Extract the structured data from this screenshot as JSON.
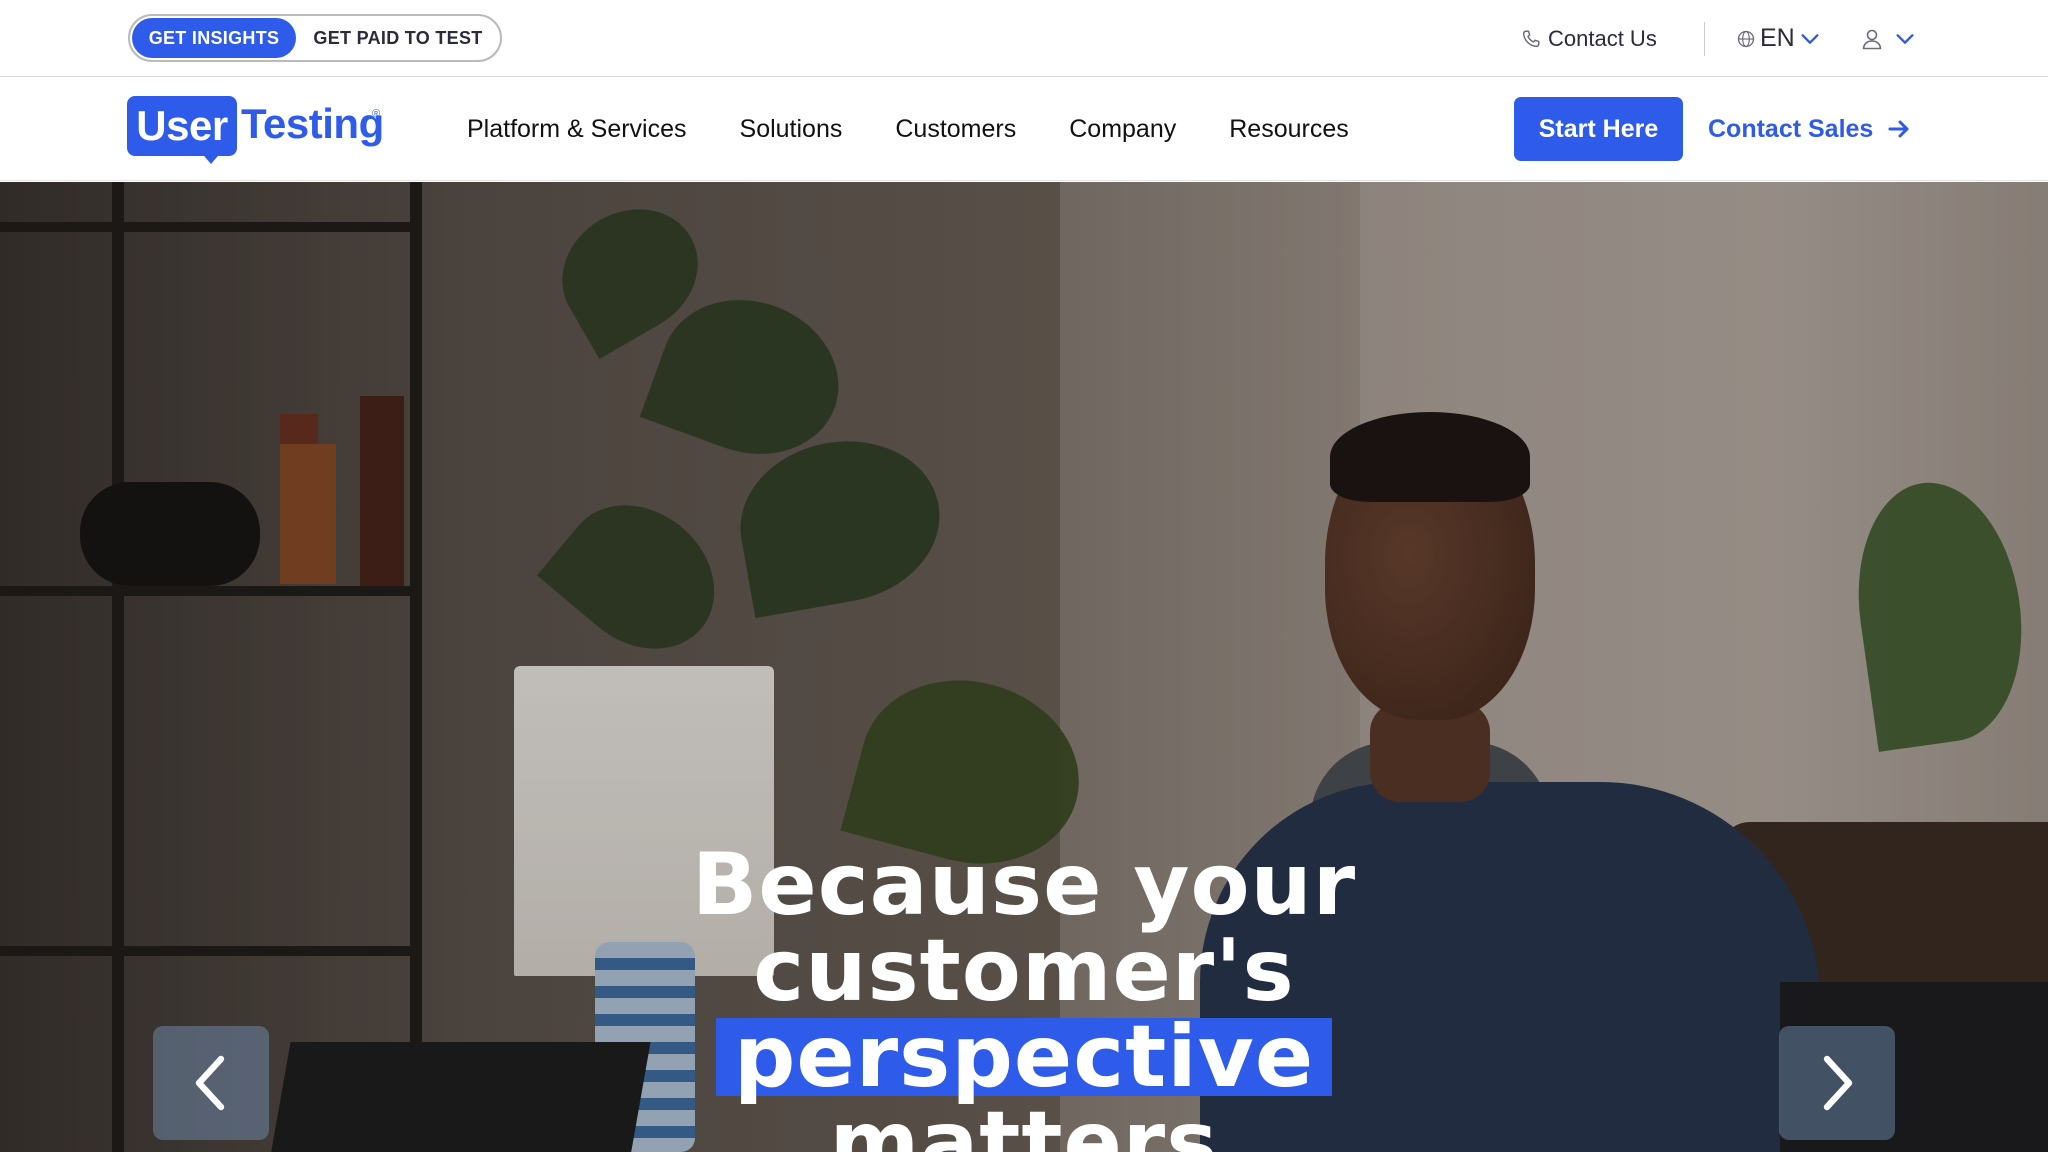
{
  "utility_bar": {
    "audience_toggle": {
      "active_label": "GET INSIGHTS",
      "inactive_label": "GET PAID TO TEST"
    },
    "contact_us": "Contact Us",
    "language": "EN"
  },
  "brand": {
    "logo_user": "User",
    "logo_testing": "Testing",
    "logo_reg": "®",
    "primary_color": "#2f5bea"
  },
  "main_nav": {
    "items": [
      {
        "label": "Platform & Services"
      },
      {
        "label": "Solutions"
      },
      {
        "label": "Customers"
      },
      {
        "label": "Company"
      },
      {
        "label": "Resources"
      }
    ],
    "start_button": "Start Here",
    "contact_sales": "Contact Sales"
  },
  "hero": {
    "heading_line_1": "Because your",
    "heading_line_2": "customer's",
    "heading_highlight": "perspective",
    "heading_line_4": "matters"
  },
  "icons": {
    "phone": "phone-icon",
    "globe": "globe-icon",
    "user": "user-icon",
    "chevron": "chevron-down-icon",
    "arrow": "arrow-right-icon",
    "prev": "chevron-left-icon",
    "next": "chevron-right-icon"
  }
}
